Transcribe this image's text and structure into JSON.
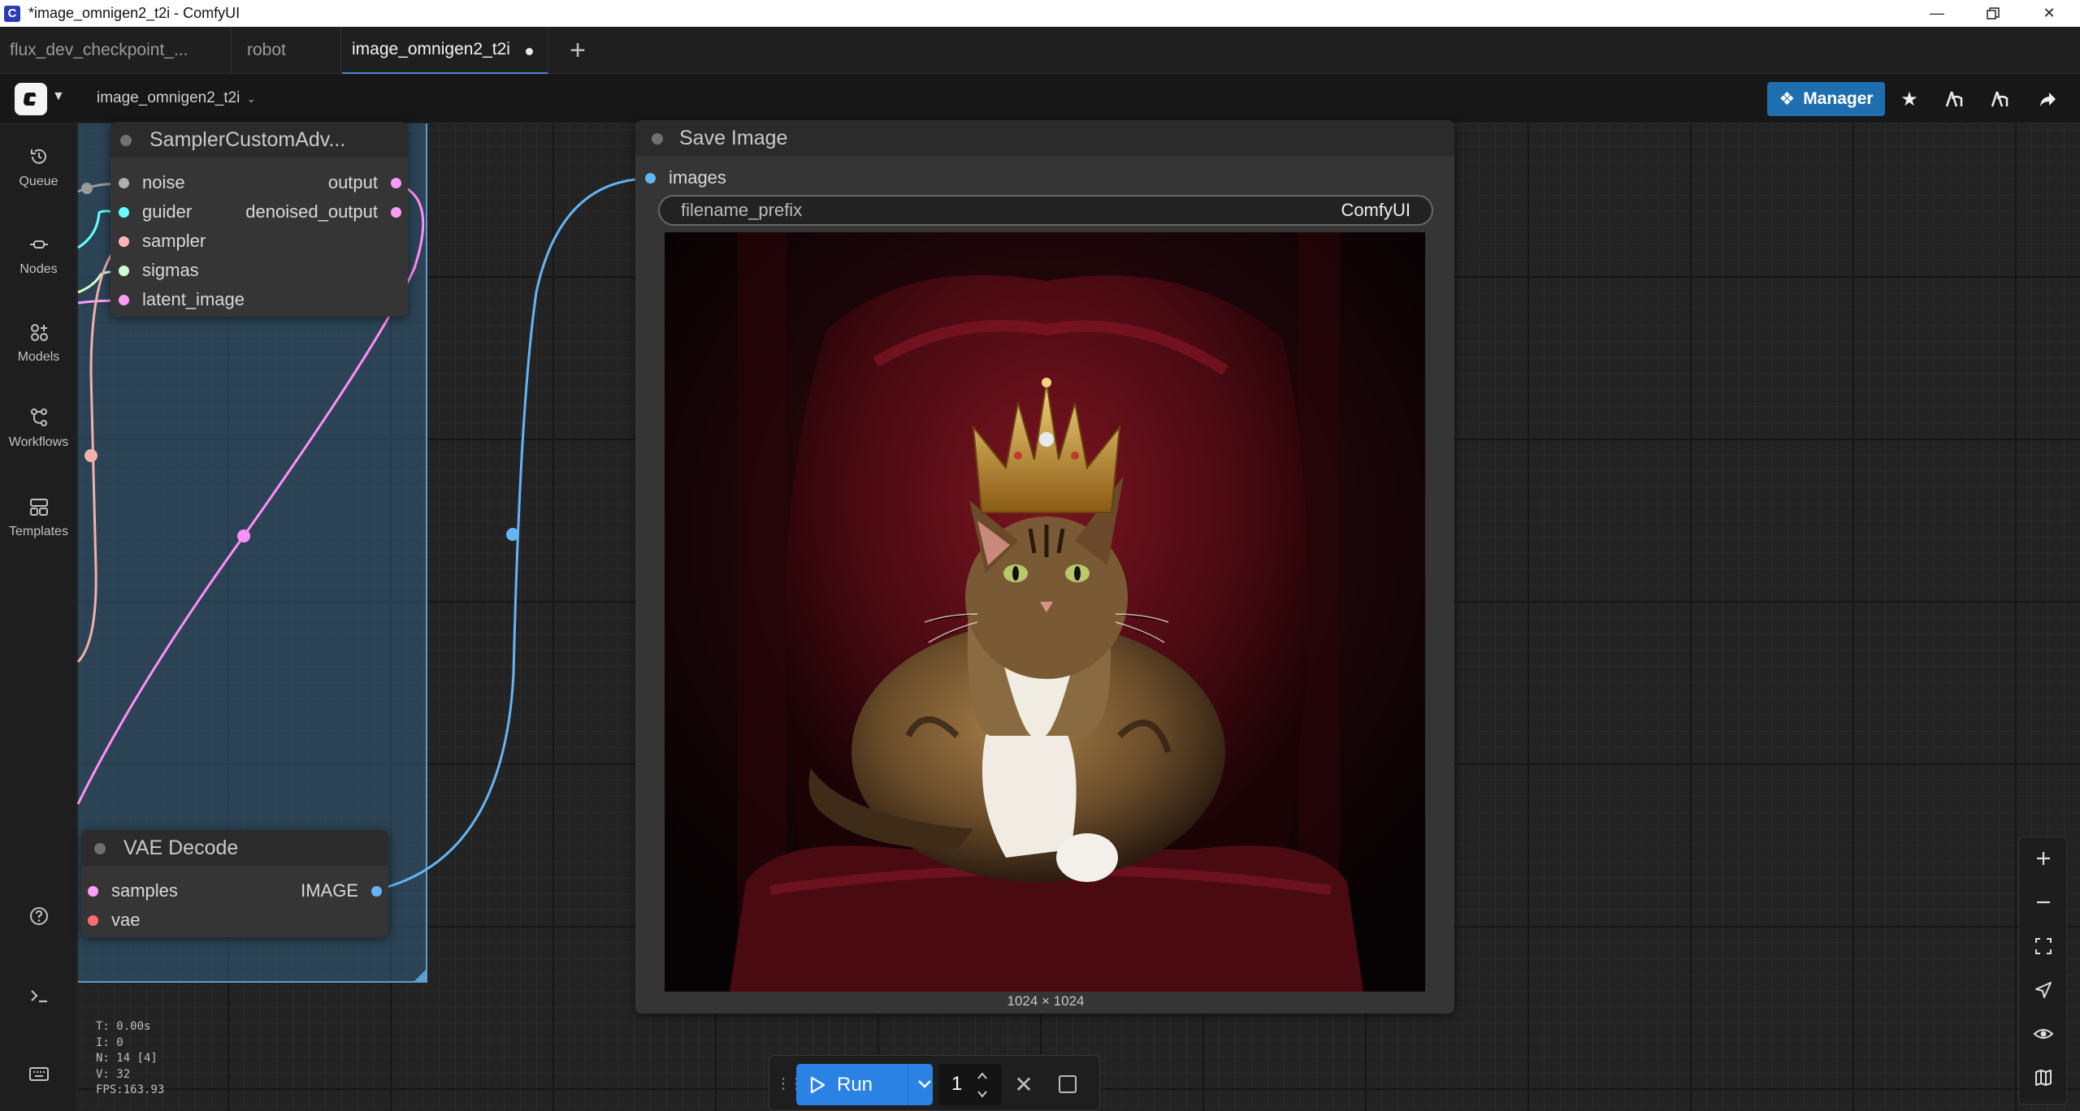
{
  "window": {
    "title": "*image_omnigen2_t2i - ComfyUI",
    "app_icon_letter": "C",
    "controls": [
      "minimize",
      "restore",
      "close"
    ]
  },
  "tabs": [
    {
      "label": "flux_dev_checkpoint_...",
      "active": false
    },
    {
      "label": "robot",
      "active": false
    },
    {
      "label": "image_omnigen2_t2i",
      "active": true,
      "unsaved": true
    }
  ],
  "menu": {
    "workflow_name": "image_omnigen2_t2i",
    "manager_label": "Manager",
    "accent_color": "#1f6fb0"
  },
  "sidebar": [
    {
      "label": "Queue",
      "icon": "history-icon"
    },
    {
      "label": "Nodes",
      "icon": "nodes-icon"
    },
    {
      "label": "Models",
      "icon": "models-icon"
    },
    {
      "label": "Workflows",
      "icon": "workflows-icon"
    },
    {
      "label": "Templates",
      "icon": "templates-icon"
    }
  ],
  "nodes": {
    "sampler": {
      "title": "SamplerCustomAdv...",
      "inputs": [
        {
          "name": "noise",
          "color": "#b0b0b0"
        },
        {
          "name": "guider",
          "color": "#66ffff"
        },
        {
          "name": "sampler",
          "color": "#ffb6b6"
        },
        {
          "name": "sigmas",
          "color": "#cdffcd"
        },
        {
          "name": "latent_image",
          "color": "#ff9cf9"
        }
      ],
      "outputs": [
        {
          "name": "output",
          "color": "#ff9cf9"
        },
        {
          "name": "denoised_output",
          "color": "#ff9cf9"
        }
      ]
    },
    "vae_decode": {
      "title": "VAE Decode",
      "inputs": [
        {
          "name": "samples",
          "color": "#ff9cf9"
        },
        {
          "name": "vae",
          "color": "#ff6e6e"
        }
      ],
      "outputs": [
        {
          "name": "IMAGE",
          "color": "#64b5f6"
        }
      ]
    },
    "save_image": {
      "title": "Save Image",
      "inputs": [
        {
          "name": "images",
          "color": "#64b5f6"
        }
      ],
      "widget": {
        "label": "filename_prefix",
        "value": "ComfyUI"
      },
      "image_size": "1024 × 1024"
    }
  },
  "stats": [
    "T: 0.00s",
    "I: 0",
    "N: 14 [4]",
    "V: 32",
    "FPS:163.93"
  ],
  "run_bar": {
    "run_label": "Run",
    "batch_count": "1",
    "run_color": "#2a82e4"
  },
  "zoom_controls": [
    "zoom-in-icon",
    "zoom-out-icon",
    "fit-view-icon",
    "select-mode-icon",
    "toggle-links-icon",
    "minimap-icon"
  ]
}
